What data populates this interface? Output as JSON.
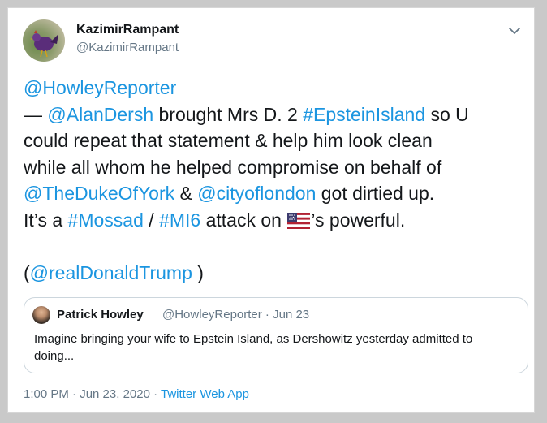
{
  "author": {
    "display_name": "KazimirRampant",
    "handle": "@KazimirRampant"
  },
  "tweet": {
    "line1": [
      "@HowleyReporter"
    ],
    "line2": [
      "— ",
      "@AlanDersh",
      " brought Mrs D. 2 ",
      "#EpsteinIsland",
      " so U"
    ],
    "line3": "could repeat that statement & help him look clean",
    "line4": "while all whom he helped compromise on behalf of",
    "line5": [
      "@TheDukeOfYork",
      " & ",
      "@cityoflondon",
      " got dirtied up."
    ],
    "line6": [
      "It’s a ",
      "#Mossad",
      " / ",
      "#MI6",
      " attack on ",
      "’s powerful."
    ],
    "line8": [
      "(",
      "@realDonaldTrump",
      " )"
    ]
  },
  "quote": {
    "name": "Patrick Howley",
    "meta": "@HowleyReporter · Jun 23",
    "text_line1": "Imagine bringing your wife to Epstein Island, as Dershowitz yesterday admitted to",
    "text_line2": "doing..."
  },
  "footer": {
    "time": "1:00 PM · Jun 23, 2020 · ",
    "source": "Twitter Web App"
  },
  "colors": {
    "link": "#1b95e0",
    "text": "#14171a",
    "muted": "#657786"
  },
  "icons": {
    "menu": "chevron-down-icon",
    "flag": "us-flag-icon"
  }
}
